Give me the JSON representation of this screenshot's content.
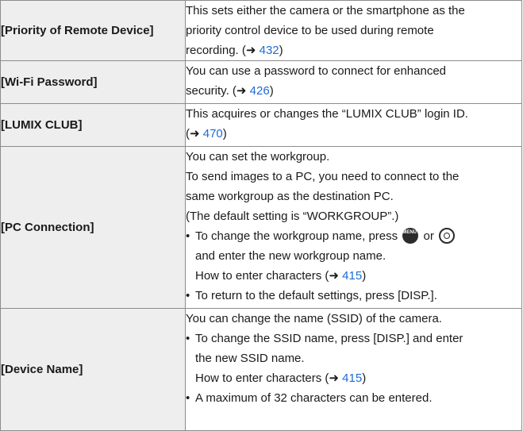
{
  "arrow": "➜",
  "rows": {
    "priority": {
      "name": "[Priority of Remote Device]",
      "line1": "This sets either the camera or the smartphone as the",
      "line2": "priority control device to be used during remote",
      "line3_pre": "recording. (",
      "line3_link": "432",
      "line3_post": ")"
    },
    "wifi": {
      "name": "[Wi-Fi Password]",
      "line1": "You can use a password to connect for enhanced",
      "line2_pre": "security. (",
      "line2_link": "426",
      "line2_post": ")"
    },
    "lumix": {
      "name": "[LUMIX CLUB]",
      "line1": "This acquires or changes the “LUMIX CLUB” login ID.",
      "line2_pre": "(",
      "line2_link": "470",
      "line2_post": ")"
    },
    "pc": {
      "name": "[PC Connection]",
      "line1": "You can set the workgroup.",
      "line2": "To send images to a PC, you need to connect to the",
      "line3": "same workgroup as the destination PC.",
      "line4": "(The default setting is “WORKGROUP”.)",
      "bullet1_pre": "To change the workgroup name, press",
      "bullet1_or": "or",
      "bullet1_line2": "and enter the new workgroup name.",
      "bullet1_line3_pre": "How to enter characters (",
      "bullet1_line3_link": "415",
      "bullet1_line3_post": ")",
      "bullet2": "To return to the default settings, press [DISP.]."
    },
    "device": {
      "name": "[Device Name]",
      "line1": "You can change the name (SSID) of the camera.",
      "bullet1_line1": "To change the SSID name, press [DISP.] and enter",
      "bullet1_line2": "the new SSID name.",
      "bullet1_line3_pre": "How to enter characters (",
      "bullet1_line3_link": "415",
      "bullet1_line3_post": ")",
      "bullet2": "A maximum of 32 characters can be entered."
    }
  },
  "icons": {
    "menu_set_text": "MENU SET"
  },
  "bullet_char": "•",
  "colors": {
    "link": "#1e6bd6",
    "label_bg": "#eeeeee",
    "border": "#8c8c8c"
  }
}
